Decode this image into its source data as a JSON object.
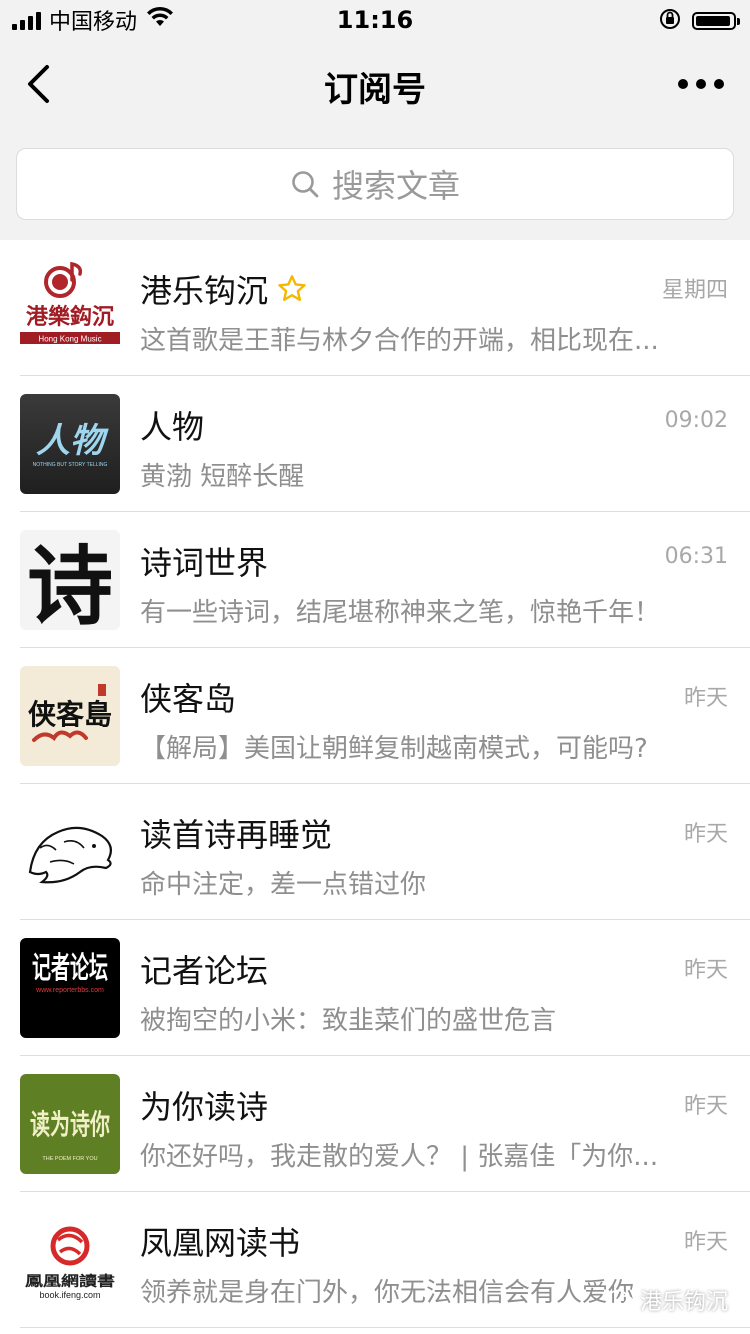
{
  "status_bar": {
    "carrier": "中国移动",
    "time": "11:16"
  },
  "nav": {
    "title": "订阅号",
    "back_icon": "chevron-left-icon",
    "more_icon": "more-dots-icon"
  },
  "search": {
    "placeholder": "搜索文章",
    "icon": "search-icon"
  },
  "accent_colors": {
    "star": "#f5b800",
    "text_secondary": "#8f8f8f",
    "background": "#f2f2f2"
  },
  "subscriptions": [
    {
      "name": "港乐钩沉",
      "starred": true,
      "time": "星期四",
      "preview": "这首歌是王菲与林夕合作的开端，相比现在...",
      "avatar_caption": "Hong Kong Music",
      "avatar_logo_text": "港樂鈎沉"
    },
    {
      "name": "人物",
      "starred": false,
      "time": "09:02",
      "preview": "黄渤 短醉长醒",
      "avatar_logo_text": "人物",
      "avatar_caption": "NOTHING BUT STORY TELLING"
    },
    {
      "name": "诗词世界",
      "starred": false,
      "time": "06:31",
      "preview": "有一些诗词，结尾堪称神来之笔，惊艳千年！",
      "avatar_logo_text": "诗"
    },
    {
      "name": "侠客岛",
      "starred": false,
      "time": "昨天",
      "preview": "【解局】美国让朝鲜复制越南模式，可能吗?",
      "avatar_logo_text": "侠客島"
    },
    {
      "name": "读首诗再睡觉",
      "starred": false,
      "time": "昨天",
      "preview": "命中注定，差一点错过你",
      "avatar_logo_text": ""
    },
    {
      "name": "记者论坛",
      "starred": false,
      "time": "昨天",
      "preview": "被掏空的小米：致韭菜们的盛世危言",
      "avatar_logo_text": "记者论坛",
      "avatar_caption": "www.reporterbbs.com"
    },
    {
      "name": "为你读诗",
      "starred": false,
      "time": "昨天",
      "preview": "你还好吗，我走散的爱人？ | 张嘉佳「为你...",
      "avatar_logo_text": "读为诗你",
      "avatar_caption": "THE POEM FOR YOU"
    },
    {
      "name": "凤凰网读书",
      "starred": false,
      "time": "昨天",
      "preview": "领养就是身在门外，你无法相信会有人爱你",
      "avatar_logo_text": "鳳凰網讀書",
      "avatar_caption": "book.ifeng.com"
    }
  ],
  "watermark": {
    "text": "港乐钩沉"
  }
}
